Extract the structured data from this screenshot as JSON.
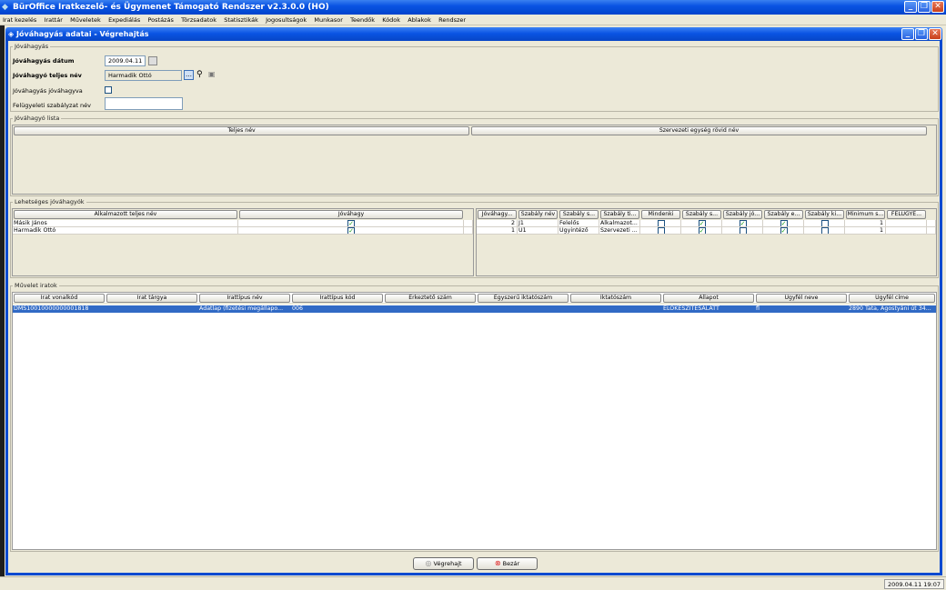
{
  "app": {
    "title": "BürOffice Iratkezelő- és Ügymenet Támogató Rendszer v2.3.0.0 (HO)"
  },
  "menu": [
    "Irat kezelés",
    "Irattár",
    "Műveletek",
    "Expediálás",
    "Postázás",
    "Törzsadatok",
    "Statisztikák",
    "Jogosultságok",
    "Munkasor",
    "Teendők",
    "Kódok",
    "Ablakok",
    "Rendszer"
  ],
  "window": {
    "title": "Jóváhagyás adatai - Végrehajtás"
  },
  "approval": {
    "group": "Jóváhagyás",
    "date_label": "Jóváhagyás dátum",
    "date_value": "2009.04.11",
    "approver_label": "Jóváhagyó teljes név",
    "approver_value": "Harmadik Ottó",
    "approved_label": "Jóváhagyás jóváhagyva",
    "rule_label": "Felügyeleti szabályzat név",
    "rule_value": ""
  },
  "approver_list": {
    "group": "Jóváhagyó lista",
    "columns": [
      "Teljes név",
      "Szervezeti egység rövid név"
    ]
  },
  "possible": {
    "group": "Lehetséges jóváhagyók",
    "left_columns": [
      "Alkalmazott teljes név",
      "Jóváhagy"
    ],
    "left_rows": [
      {
        "name": "Másik János",
        "approve": "✓"
      },
      {
        "name": "Harmadik Ottó",
        "approve": "✓"
      }
    ],
    "right_columns": [
      "Jóváhagy...",
      "Szabály név",
      "Szabály s...",
      "Szabály ti...",
      "Mindenki",
      "Szabály s...",
      "Szabály jó...",
      "Szabály e...",
      "Szabály ki...",
      "Minimum s...",
      "FELUGYE..."
    ],
    "right_rows": [
      {
        "c0": "2",
        "c1": "J1",
        "c2": "Felelős",
        "c3": "Alkalmazot...",
        "c4": "",
        "c5": "✓",
        "c6": "✓",
        "c7": "✓",
        "c8": "",
        "c9": "1"
      },
      {
        "c0": "1",
        "c1": "U1",
        "c2": "Ügyintéző",
        "c3": "Szervezeti ...",
        "c4": "",
        "c5": "✓",
        "c6": "",
        "c7": "✓",
        "c8": "",
        "c9": "1"
      }
    ]
  },
  "docs": {
    "group": "Művelet iratok",
    "columns": [
      "Irat vonalkód",
      "Irat tárgya",
      "Irattípus név",
      "Irattípus kód",
      "Érkeztető szám",
      "Egyszerű iktatószám",
      "Iktatószám",
      "Állapot",
      "Ügyfél neve",
      "Ügyfél címe"
    ],
    "rows": [
      {
        "c0": "DMS10010000000001818",
        "c1": "",
        "c2": "Adatlap (fizetési megállapo...",
        "c3": "006",
        "c4": "",
        "c5": "",
        "c6": "",
        "c7": "ELOKESZITESALATT",
        "c8": "fl",
        "c9": "2890 Tata, Agostyáni út 34..."
      }
    ]
  },
  "actions": {
    "execute": "Végrehajt",
    "close": "Bezár"
  },
  "status": {
    "datetime": "2009.04.11 19:07"
  },
  "colors": {
    "accent": "#0a54e3",
    "selection": "#316ac5",
    "check": "#21a121"
  }
}
